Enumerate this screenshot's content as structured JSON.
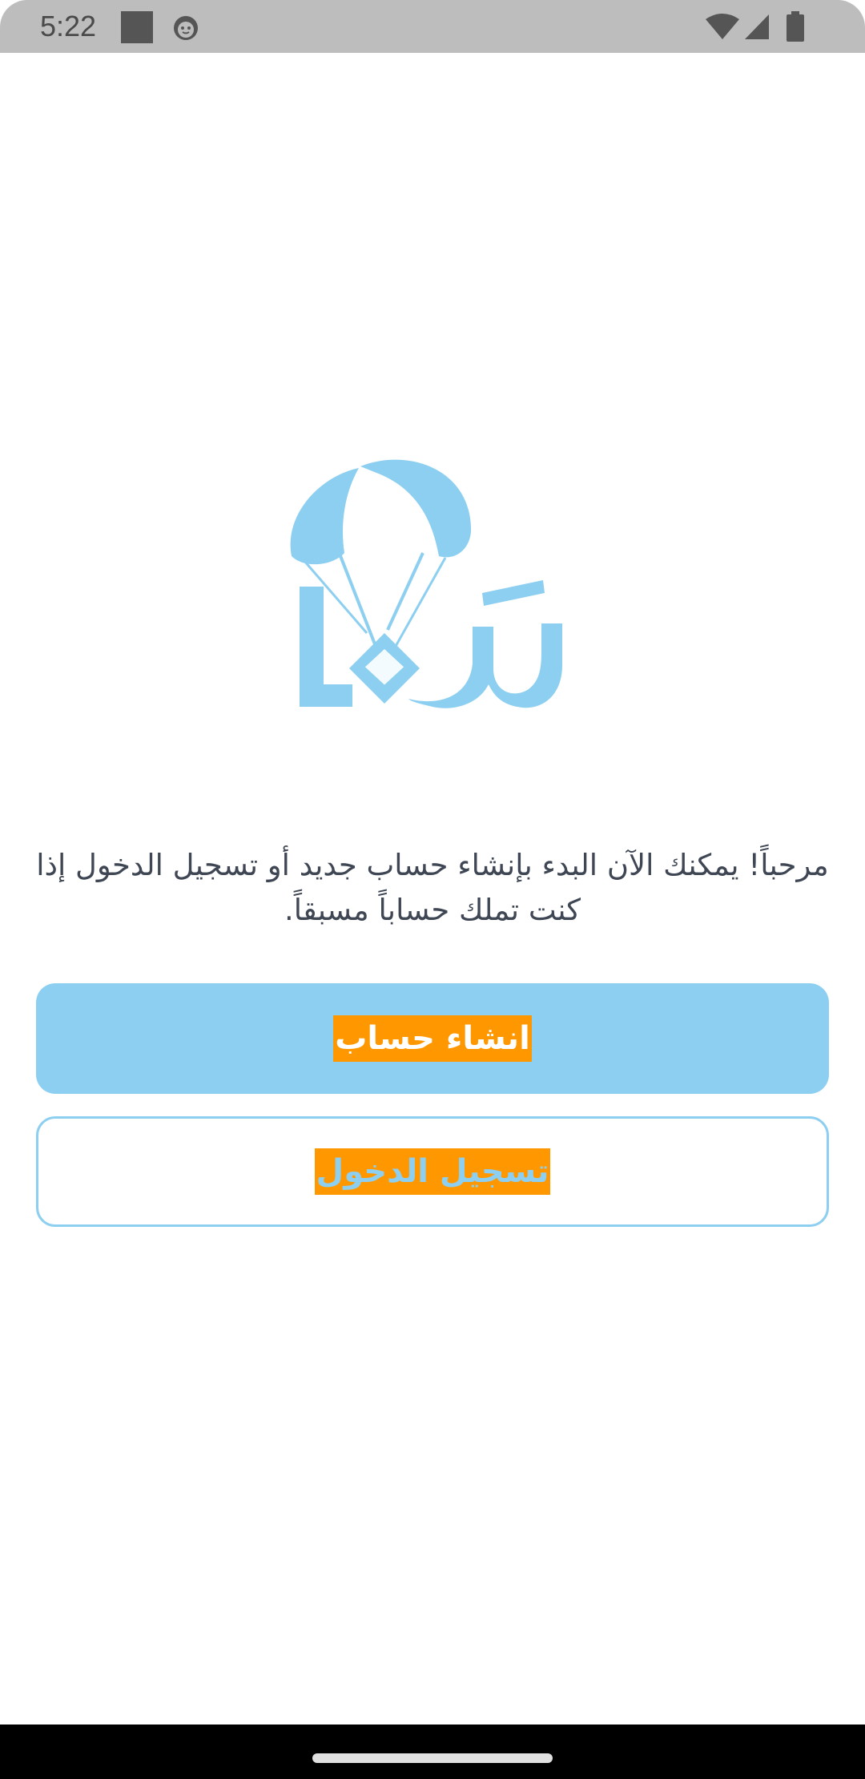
{
  "status_bar": {
    "time": "5:22",
    "icons": [
      "notification-square-icon",
      "android-face-icon",
      "wifi-icon",
      "cell-signal-icon",
      "battery-icon"
    ]
  },
  "logo": {
    "icon": "parachute-logo-icon",
    "color": "#8dcff0"
  },
  "welcome": {
    "text": "مرحباً! يمكنك الآن البدء بإنشاء حساب جديد أو تسجيل الدخول إذا كنت تملك حساباً مسبقاً."
  },
  "buttons": {
    "create_account": "انشاء حساب",
    "login": "تسجيل الدخول"
  },
  "colors": {
    "accent": "#8dcff0",
    "label_highlight": "#ff9800",
    "text": "#3f4654"
  }
}
